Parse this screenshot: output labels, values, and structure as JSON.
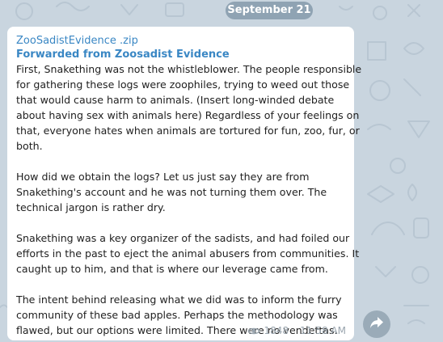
{
  "chat": {
    "date_separator": "September 21"
  },
  "message": {
    "file_name": "ZooSadistEvidence .zip",
    "forwarded_from": "Forwarded from Zoosadist Evidence",
    "paragraphs": [
      [
        "First, Snakething was not the whistleblower. The people responsible",
        "for gathering these logs were zoophiles, trying to weed out those",
        "that would cause harm to animals. (Insert long-winded debate",
        "about having sex with animals here) Regardless of your feelings on",
        "that, everyone hates when animals are tortured for fun, zoo, fur, or",
        "both."
      ],
      [
        "How did we obtain the logs? Let us just say they are from",
        "Snakething's account and he was not turning them over. The",
        "technical jargon is rather dry."
      ],
      [
        "Snakething was a key organizer of the sadists, and had foiled our",
        "efforts in the past to eject the animal abusers from communities. It",
        "caught up to him, and that is where our leverage came from."
      ],
      [
        "The intent behind releasing what we did was to inform the furry",
        "community of these bad apples. Perhaps the methodology was",
        "flawed, but our options were limited. There were no vendettas."
      ]
    ],
    "views": "1848",
    "time": "11:58 AM"
  },
  "icons": {
    "views_icon": "eye-icon",
    "share_icon": "share-arrow-icon"
  },
  "colors": {
    "background": "#c9d5df",
    "date_chip": "#8fa3b3",
    "link": "#3a87c4",
    "meta": "#9aa5ae",
    "share_button": "#9aabb8"
  }
}
